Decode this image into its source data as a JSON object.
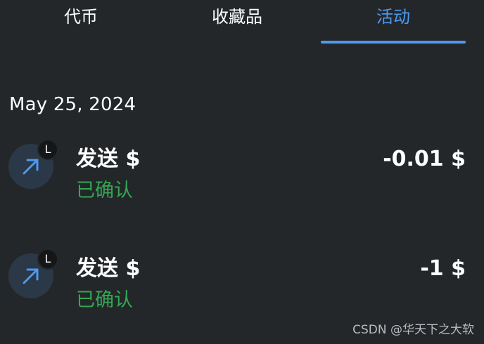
{
  "tabs": [
    {
      "label": "代币",
      "active": false
    },
    {
      "label": "收藏品",
      "active": false
    },
    {
      "label": "活动",
      "active": true
    }
  ],
  "colors": {
    "background": "#24272a",
    "accent": "#4d9af0",
    "confirmed": "#32a852"
  },
  "activity": {
    "date": "May 25, 2024",
    "transactions": [
      {
        "icon": "arrow-up-right-icon",
        "network_badge": "L",
        "title": "发送 $",
        "status": "已确认",
        "amount": "-0.01 $"
      },
      {
        "icon": "arrow-up-right-icon",
        "network_badge": "L",
        "title": "发送 $",
        "status": "已确认",
        "amount": "-1 $"
      }
    ]
  },
  "watermark": "CSDN @华天下之大软"
}
